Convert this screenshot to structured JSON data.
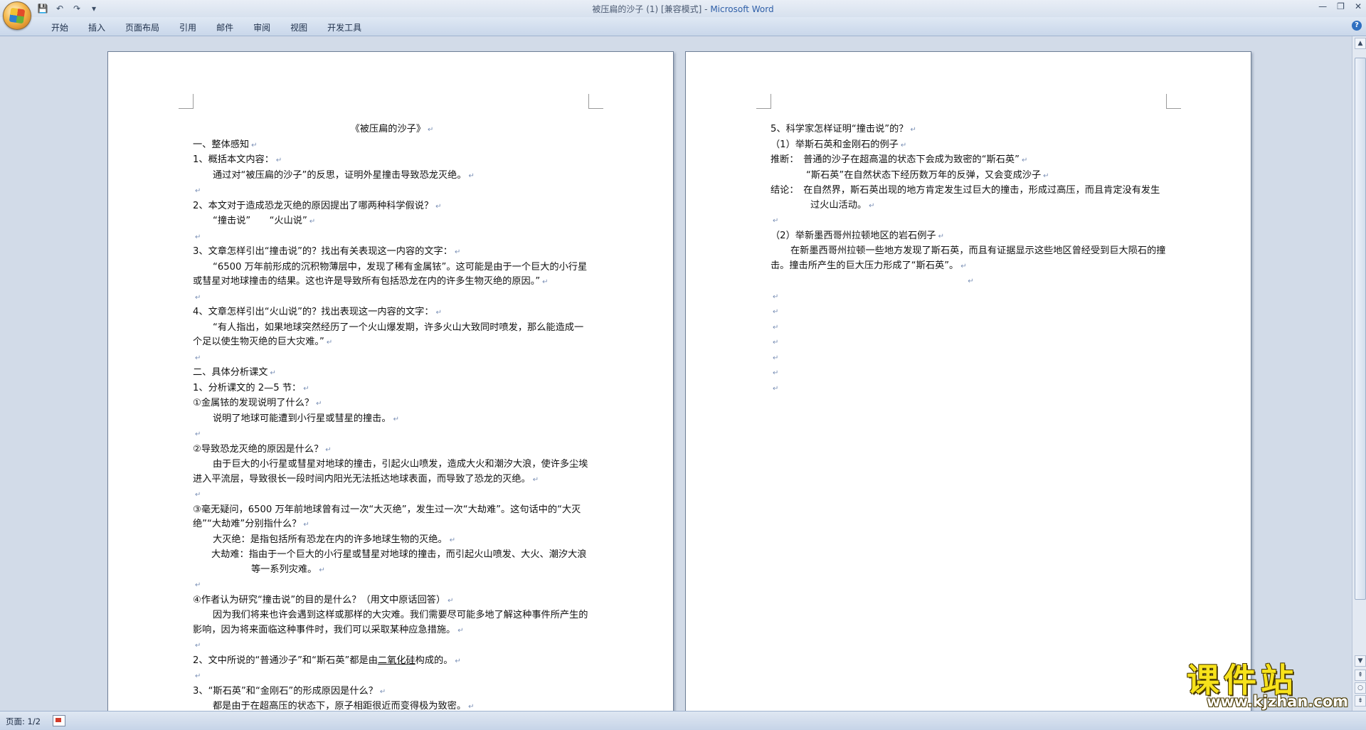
{
  "window": {
    "doc_name": "被压扁的沙子 (1) [兼容模式] - ",
    "app_name": "Microsoft Word"
  },
  "qat": {
    "save_icon": "save-icon",
    "undo_icon": "undo-icon",
    "redo_icon": "redo-icon",
    "customize_icon": "customize-icon"
  },
  "ribbon": {
    "tabs": [
      "开始",
      "插入",
      "页面布局",
      "引用",
      "邮件",
      "审阅",
      "视图",
      "开发工具"
    ]
  },
  "page1": {
    "lines": [
      "《被压扁的沙子》",
      "一、整体感知",
      "1、概括本文内容：",
      "通过对“被压扁的沙子”的反思，证明外星撞击导致恐龙灭绝。",
      "",
      "2、本文对于造成恐龙灭绝的原因提出了哪两种科学假说？",
      "“撞击说”　　“火山说”",
      "",
      "3、文章怎样引出“撞击说”的？找出有关表现这一内容的文字：",
      "“6500 万年前形成的沉积物薄层中，发现了稀有金属铱”。这可能是由于一个巨大的小行星或彗星对地球撞击的结果。这也许是导致所有包括恐龙在内的许多生物灭绝的原因。”",
      "",
      "4、文章怎样引出“火山说”的？找出表现这一内容的文字：",
      "“有人指出，如果地球突然经历了一个火山爆发期，许多火山大致同时喷发，那么能造成一个足以使生物灭绝的巨大灾难。”",
      "",
      "二、具体分析课文",
      "1、分析课文的 2—5 节：",
      "①金属铱的发现说明了什么？",
      "说明了地球可能遭到小行星或彗星的撞击。",
      "",
      "②导致恐龙灭绝的原因是什么？",
      "由于巨大的小行星或彗星对地球的撞击，引起火山喷发，造成大火和潮汐大浪，使许多尘埃进入平流层，导致很长一段时间内阳光无法抵达地球表面，而导致了恐龙的灭绝。",
      "",
      "③毫无疑问，6500 万年前地球曾有过一次“大灭绝”，发生过一次“大劫难”。这句话中的“大灭绝”“大劫难”分别指什么？",
      "大灭绝：是指包括所有恐龙在内的许多地球生物的灭绝。",
      "大劫难：指由于一个巨大的小行星或彗星对地球的撞击，而引起火山喷发、大火、潮汐大浪等一系列灾难。",
      "",
      "④作者认为研究“撞击说”的目的是什么？（用文中原话回答）",
      "因为我们将来也许会遇到这样或那样的大灾难。我们需要尽可能多地了解这种事件所产生的影响，因为将来面临这种事件时，我们可以采取某种应急措施。",
      "",
      "2、文中所说的“普通沙子”和“斯石英”都是由",
      "二氧化硅",
      "构成的。",
      "",
      "3、“斯石英”和“金刚石”的形成原因是什么？",
      "都是由于在超高压的状态下，原子相距很近而变得极为致密。"
    ]
  },
  "page2": {
    "lines": [
      "5、科学家怎样证明“撞击说”的？",
      "（1）举斯石英和金刚石的例子",
      "推断：　普通的沙子在超高温的状态下会成为致密的“斯石英”",
      "“斯石英”在自然状态下经历数万年的反弹，又会变成沙子",
      "结论：　在自然界，斯石英出现的地方肯定发生过巨大的撞击，形成过高压，而且肯定没有发生过火山活动。",
      "",
      "（2）举新墨西哥州拉顿地区的岩石例子",
      "在新墨西哥州拉顿一些地方发现了斯石英，而且有证据显示这些地区曾经受到巨大陨石的撞击。撞击所产生的巨大压力形成了“斯石英”。"
    ]
  },
  "status": {
    "page": "页面: 1/2"
  },
  "watermark": {
    "title": "课件站",
    "url": "www.kjzhan.com"
  }
}
